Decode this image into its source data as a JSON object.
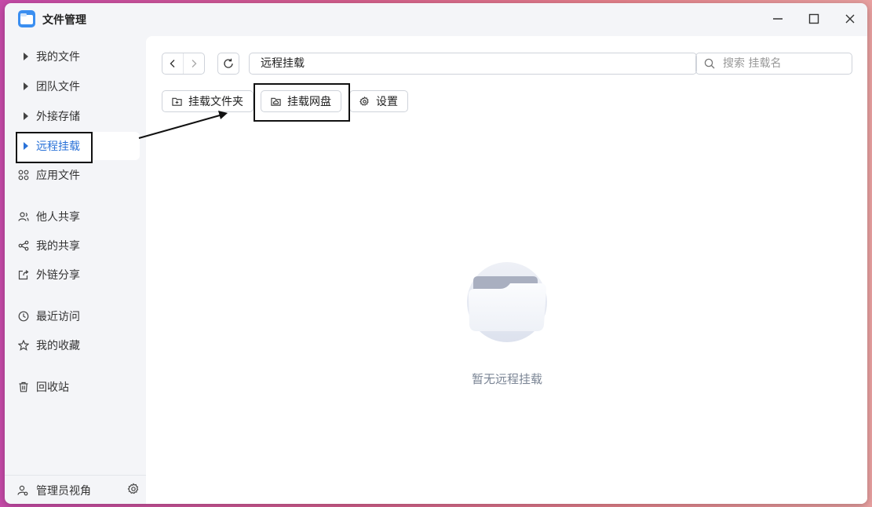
{
  "window": {
    "title": "文件管理"
  },
  "sidebar": {
    "items": [
      {
        "label": "我的文件"
      },
      {
        "label": "团队文件"
      },
      {
        "label": "外接存储"
      },
      {
        "label": "远程挂载"
      },
      {
        "label": "应用文件"
      },
      {
        "label": "他人共享"
      },
      {
        "label": "我的共享"
      },
      {
        "label": "外链分享"
      },
      {
        "label": "最近访问"
      },
      {
        "label": "我的收藏"
      },
      {
        "label": "回收站"
      }
    ],
    "active_index": 3,
    "footer_label": "管理员视角"
  },
  "toolbar": {
    "path": "远程挂载",
    "search_placeholder": "搜索 挂载名",
    "buttons": [
      {
        "label": "挂载文件夹"
      },
      {
        "label": "挂载网盘"
      },
      {
        "label": "设置"
      }
    ]
  },
  "empty_state": {
    "text": "暂无远程挂载"
  },
  "colors": {
    "accent": "#2a72d8",
    "annotation": "#111111"
  }
}
